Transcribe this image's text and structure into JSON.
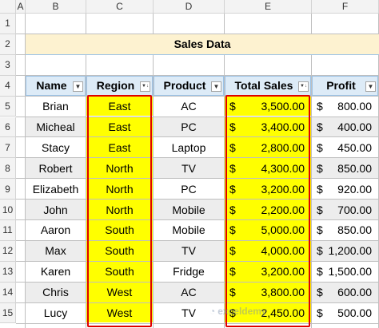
{
  "sheet": {
    "columns": [
      "A",
      "B",
      "C",
      "D",
      "E",
      "F"
    ],
    "rows": [
      "1",
      "2",
      "3",
      "4",
      "5",
      "6",
      "7",
      "8",
      "9",
      "10",
      "11",
      "12",
      "13",
      "14",
      "15"
    ],
    "title": "Sales Data",
    "headers": [
      "Name",
      "Region",
      "Product",
      "Total Sales",
      "Profit"
    ],
    "filter_icons": [
      "dropdown-icon",
      "sort-filter-icon",
      "dropdown-icon",
      "sort-filter-icon",
      "dropdown-icon"
    ],
    "data": [
      {
        "name": "Brian",
        "region": "East",
        "product": "AC",
        "sales_sym": "$",
        "sales": "3,500.00",
        "profit_sym": "$",
        "profit": "800.00"
      },
      {
        "name": "Micheal",
        "region": "East",
        "product": "PC",
        "sales_sym": "$",
        "sales": "3,400.00",
        "profit_sym": "$",
        "profit": "400.00"
      },
      {
        "name": "Stacy",
        "region": "East",
        "product": "Laptop",
        "sales_sym": "$",
        "sales": "2,800.00",
        "profit_sym": "$",
        "profit": "450.00"
      },
      {
        "name": "Robert",
        "region": "North",
        "product": "TV",
        "sales_sym": "$",
        "sales": "4,300.00",
        "profit_sym": "$",
        "profit": "850.00"
      },
      {
        "name": "Elizabeth",
        "region": "North",
        "product": "PC",
        "sales_sym": "$",
        "sales": "3,200.00",
        "profit_sym": "$",
        "profit": "920.00"
      },
      {
        "name": "John",
        "region": "North",
        "product": "Mobile",
        "sales_sym": "$",
        "sales": "2,200.00",
        "profit_sym": "$",
        "profit": "700.00"
      },
      {
        "name": "Aaron",
        "region": "South",
        "product": "Mobile",
        "sales_sym": "$",
        "sales": "5,000.00",
        "profit_sym": "$",
        "profit": "850.00"
      },
      {
        "name": "Max",
        "region": "South",
        "product": "TV",
        "sales_sym": "$",
        "sales": "4,000.00",
        "profit_sym": "$",
        "profit": "1,200.00"
      },
      {
        "name": "Karen",
        "region": "South",
        "product": "Fridge",
        "sales_sym": "$",
        "sales": "3,200.00",
        "profit_sym": "$",
        "profit": "1,500.00"
      },
      {
        "name": "Chris",
        "region": "West",
        "product": "AC",
        "sales_sym": "$",
        "sales": "3,800.00",
        "profit_sym": "$",
        "profit": "600.00"
      },
      {
        "name": "Lucy",
        "region": "West",
        "product": "TV",
        "sales_sym": "$",
        "sales": "2,450.00",
        "profit_sym": "$",
        "profit": "500.00"
      }
    ]
  },
  "watermark": "exceldemy",
  "colors": {
    "highlight": "#ffff00",
    "header_fill": "#ddebf7",
    "title_fill": "#fdf2d0",
    "stripe_fill": "#ededed",
    "red_outline": "#e00000"
  }
}
